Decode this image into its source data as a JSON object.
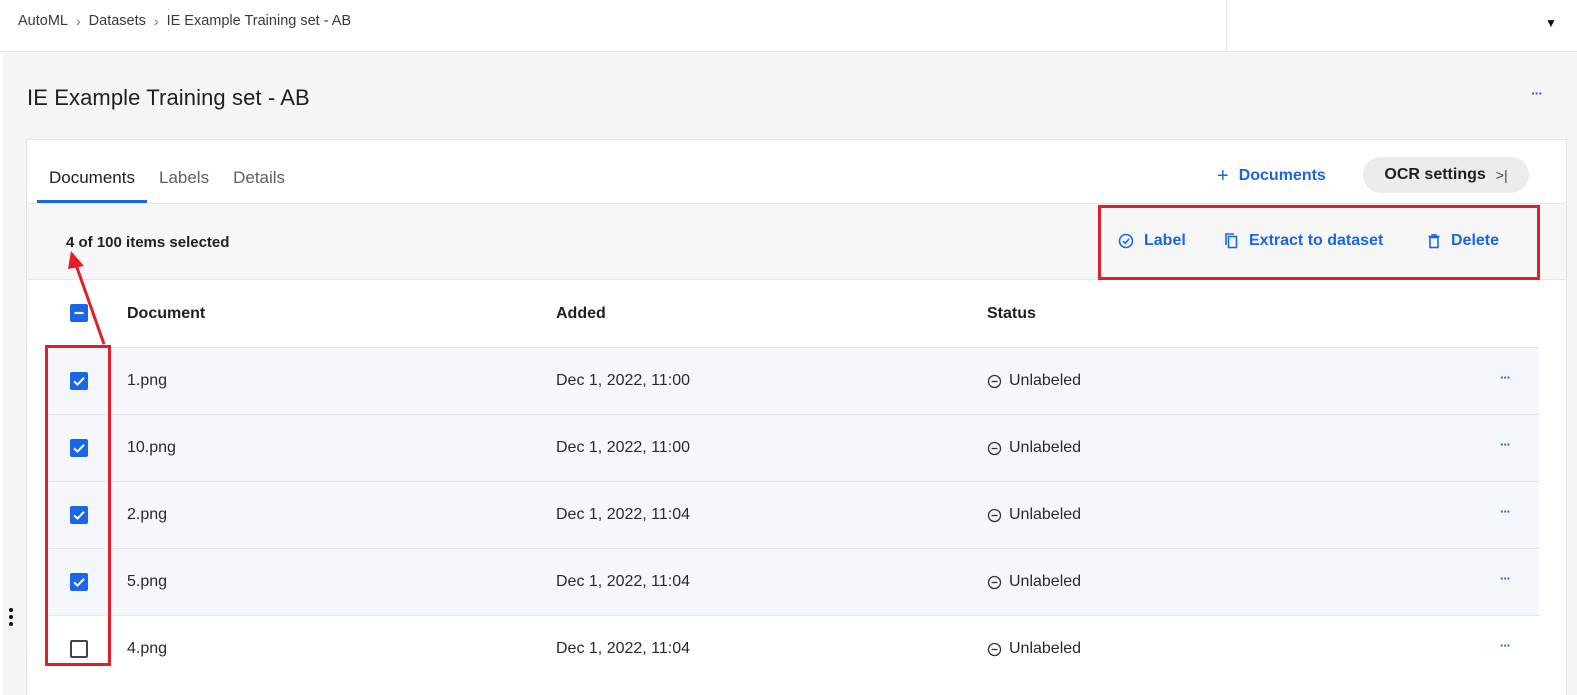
{
  "breadcrumb": {
    "items": [
      "AutoML",
      "Datasets",
      "IE Example Training set - AB"
    ]
  },
  "page": {
    "title": "IE Example Training set - AB",
    "more_label": "···"
  },
  "tabs": [
    {
      "label": "Documents",
      "active": true
    },
    {
      "label": "Labels",
      "active": false
    },
    {
      "label": "Details",
      "active": false
    }
  ],
  "toolbar": {
    "add_documents_label": "Documents",
    "ocr_settings_label": "OCR settings"
  },
  "selection": {
    "summary": "4 of 100 items selected",
    "actions": {
      "label": "Label",
      "extract": "Extract to dataset",
      "delete": "Delete"
    }
  },
  "table": {
    "columns": [
      "Document",
      "Added",
      "Status"
    ],
    "rows": [
      {
        "document": "1.png",
        "added": "Dec 1, 2022, 11:00",
        "status": "Unlabeled",
        "checked": true
      },
      {
        "document": "10.png",
        "added": "Dec 1, 2022, 11:00",
        "status": "Unlabeled",
        "checked": true
      },
      {
        "document": "2.png",
        "added": "Dec 1, 2022, 11:04",
        "status": "Unlabeled",
        "checked": true
      },
      {
        "document": "5.png",
        "added": "Dec 1, 2022, 11:04",
        "status": "Unlabeled",
        "checked": true
      },
      {
        "document": "4.png",
        "added": "Dec 1, 2022, 11:04",
        "status": "Unlabeled",
        "checked": false
      }
    ],
    "row_more_label": "···"
  },
  "colors": {
    "accent": "#1a66e6",
    "highlight": "#e11f26",
    "selected_row": "#f4f7fb"
  }
}
